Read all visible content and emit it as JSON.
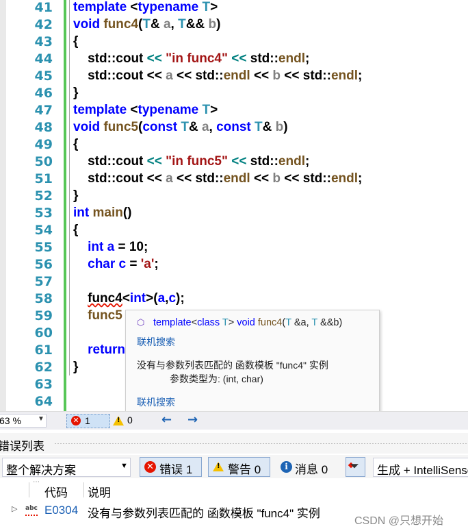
{
  "editor": {
    "lines": [
      {
        "num": "41",
        "tokens": [
          {
            "t": "template",
            "c": "kw"
          },
          {
            "t": " <",
            "c": ""
          },
          {
            "t": "typename",
            "c": "kw"
          },
          {
            "t": " ",
            "c": ""
          },
          {
            "t": "T",
            "c": "type"
          },
          {
            "t": ">",
            "c": ""
          }
        ]
      },
      {
        "num": "42",
        "tokens": [
          {
            "t": "void",
            "c": "kw"
          },
          {
            "t": " ",
            "c": ""
          },
          {
            "t": "func4",
            "c": "fn"
          },
          {
            "t": "(",
            "c": ""
          },
          {
            "t": "T",
            "c": "type"
          },
          {
            "t": "& ",
            "c": ""
          },
          {
            "t": "a",
            "c": "var"
          },
          {
            "t": ", ",
            "c": ""
          },
          {
            "t": "T",
            "c": "type"
          },
          {
            "t": "&& ",
            "c": ""
          },
          {
            "t": "b",
            "c": "var"
          },
          {
            "t": ")",
            "c": ""
          }
        ]
      },
      {
        "num": "43",
        "tokens": [
          {
            "t": "{",
            "c": ""
          }
        ]
      },
      {
        "num": "44",
        "tokens": [
          {
            "t": "    std::cout ",
            "c": ""
          },
          {
            "t": "<<",
            "c": "op"
          },
          {
            "t": " ",
            "c": ""
          },
          {
            "t": "\"in func4\"",
            "c": "str"
          },
          {
            "t": " ",
            "c": ""
          },
          {
            "t": "<<",
            "c": "op"
          },
          {
            "t": " std::",
            "c": ""
          },
          {
            "t": "endl",
            "c": "fn"
          },
          {
            "t": ";",
            "c": ""
          }
        ]
      },
      {
        "num": "45",
        "tokens": [
          {
            "t": "    std::cout << ",
            "c": ""
          },
          {
            "t": "a",
            "c": "var"
          },
          {
            "t": " << std::",
            "c": ""
          },
          {
            "t": "endl",
            "c": "fn"
          },
          {
            "t": " << ",
            "c": ""
          },
          {
            "t": "b",
            "c": "var"
          },
          {
            "t": " << std::",
            "c": ""
          },
          {
            "t": "endl",
            "c": "fn"
          },
          {
            "t": ";",
            "c": ""
          }
        ]
      },
      {
        "num": "46",
        "tokens": [
          {
            "t": "}",
            "c": ""
          }
        ]
      },
      {
        "num": "47",
        "tokens": [
          {
            "t": "template",
            "c": "kw"
          },
          {
            "t": " <",
            "c": ""
          },
          {
            "t": "typename",
            "c": "kw"
          },
          {
            "t": " ",
            "c": ""
          },
          {
            "t": "T",
            "c": "type"
          },
          {
            "t": ">",
            "c": ""
          }
        ]
      },
      {
        "num": "48",
        "tokens": [
          {
            "t": "void",
            "c": "kw"
          },
          {
            "t": " ",
            "c": ""
          },
          {
            "t": "func5",
            "c": "fn"
          },
          {
            "t": "(",
            "c": ""
          },
          {
            "t": "const",
            "c": "kw"
          },
          {
            "t": " ",
            "c": ""
          },
          {
            "t": "T",
            "c": "type"
          },
          {
            "t": "& ",
            "c": ""
          },
          {
            "t": "a",
            "c": "var"
          },
          {
            "t": ", ",
            "c": ""
          },
          {
            "t": "const",
            "c": "kw"
          },
          {
            "t": " ",
            "c": ""
          },
          {
            "t": "T",
            "c": "type"
          },
          {
            "t": "& ",
            "c": ""
          },
          {
            "t": "b",
            "c": "var"
          },
          {
            "t": ")",
            "c": ""
          }
        ]
      },
      {
        "num": "49",
        "tokens": [
          {
            "t": "{",
            "c": ""
          }
        ]
      },
      {
        "num": "50",
        "tokens": [
          {
            "t": "    std::cout ",
            "c": ""
          },
          {
            "t": "<<",
            "c": "op"
          },
          {
            "t": " ",
            "c": ""
          },
          {
            "t": "\"in func5\"",
            "c": "str"
          },
          {
            "t": " ",
            "c": ""
          },
          {
            "t": "<<",
            "c": "op"
          },
          {
            "t": " std::",
            "c": ""
          },
          {
            "t": "endl",
            "c": "fn"
          },
          {
            "t": ";",
            "c": ""
          }
        ]
      },
      {
        "num": "51",
        "tokens": [
          {
            "t": "    std::cout << ",
            "c": ""
          },
          {
            "t": "a",
            "c": "var"
          },
          {
            "t": " << std::",
            "c": ""
          },
          {
            "t": "endl",
            "c": "fn"
          },
          {
            "t": " << ",
            "c": ""
          },
          {
            "t": "b",
            "c": "var"
          },
          {
            "t": " << std::",
            "c": ""
          },
          {
            "t": "endl",
            "c": "fn"
          },
          {
            "t": ";",
            "c": ""
          }
        ]
      },
      {
        "num": "52",
        "tokens": [
          {
            "t": "}",
            "c": ""
          }
        ]
      },
      {
        "num": "53",
        "tokens": [
          {
            "t": "int",
            "c": "kw"
          },
          {
            "t": " ",
            "c": ""
          },
          {
            "t": "main",
            "c": "fn"
          },
          {
            "t": "()",
            "c": ""
          }
        ]
      },
      {
        "num": "54",
        "tokens": [
          {
            "t": "{",
            "c": ""
          }
        ]
      },
      {
        "num": "55",
        "tokens": [
          {
            "t": "    ",
            "c": ""
          },
          {
            "t": "int",
            "c": "kw"
          },
          {
            "t": " ",
            "c": ""
          },
          {
            "t": "a",
            "c": "kw"
          },
          {
            "t": " = ",
            "c": ""
          },
          {
            "t": "10",
            "c": "num"
          },
          {
            "t": ";",
            "c": ""
          }
        ]
      },
      {
        "num": "56",
        "tokens": [
          {
            "t": "    ",
            "c": ""
          },
          {
            "t": "char",
            "c": "kw"
          },
          {
            "t": " ",
            "c": ""
          },
          {
            "t": "c",
            "c": "kw"
          },
          {
            "t": " = ",
            "c": ""
          },
          {
            "t": "'a'",
            "c": "str"
          },
          {
            "t": ";",
            "c": ""
          }
        ]
      },
      {
        "num": "57",
        "tokens": []
      },
      {
        "num": "58",
        "tokens": [
          {
            "t": "    ",
            "c": ""
          },
          {
            "t": "func4",
            "c": "squig"
          },
          {
            "t": "<",
            "c": ""
          },
          {
            "t": "int",
            "c": "kw"
          },
          {
            "t": ">(",
            "c": ""
          },
          {
            "t": "a",
            "c": "kw"
          },
          {
            "t": ",",
            "c": ""
          },
          {
            "t": "c",
            "c": "kw"
          },
          {
            "t": ");",
            "c": ""
          }
        ]
      },
      {
        "num": "59",
        "tokens": [
          {
            "t": "    ",
            "c": ""
          },
          {
            "t": "func5",
            "c": "fn"
          }
        ]
      },
      {
        "num": "60",
        "tokens": []
      },
      {
        "num": "61",
        "tokens": [
          {
            "t": "    ",
            "c": ""
          },
          {
            "t": "return",
            "c": "kw"
          }
        ]
      },
      {
        "num": "62",
        "tokens": [
          {
            "t": "}",
            "c": ""
          }
        ]
      },
      {
        "num": "63",
        "tokens": []
      },
      {
        "num": "64",
        "tokens": []
      }
    ]
  },
  "tooltip": {
    "icon": "template-icon",
    "signature": {
      "kw_template": "template",
      "lt": "<",
      "kw_class": "class",
      "tparam": " T",
      "gt": "> ",
      "kw_void": "void",
      "fname": " func4",
      "params_open": "(",
      "ptype1": "T",
      "param1": " &a, ",
      "ptype2": "T",
      "param2": " &&b)"
    },
    "link1": "联机搜索",
    "message": "没有与参数列表匹配的 函数模板 \"func4\" 实例",
    "detail": "参数类型为:  (int, char)",
    "link2": "联机搜索"
  },
  "statusbar": {
    "zoom": "63 %",
    "error_count": "1",
    "warning_count": "0",
    "nav_back": "←",
    "nav_forward": "→"
  },
  "error_list": {
    "title": "错误列表",
    "scope": "整个解决方案",
    "errors_label": "错误 1",
    "warnings_label": "警告 0",
    "messages_label": "消息 0",
    "build_filter": "生成 + IntelliSense",
    "columns": {
      "code": "代码",
      "description": "说明"
    },
    "rows": [
      {
        "code": "E0304",
        "description": "没有与参数列表匹配的 函数模板 \"func4\" 实例"
      }
    ]
  },
  "watermark": "CSDN @只想开始",
  "colors": {
    "keyword": "#0000ff",
    "type": "#2b91af",
    "function": "#74531f",
    "string": "#a31515",
    "error": "#e51400",
    "change_bar": "#57c657"
  }
}
